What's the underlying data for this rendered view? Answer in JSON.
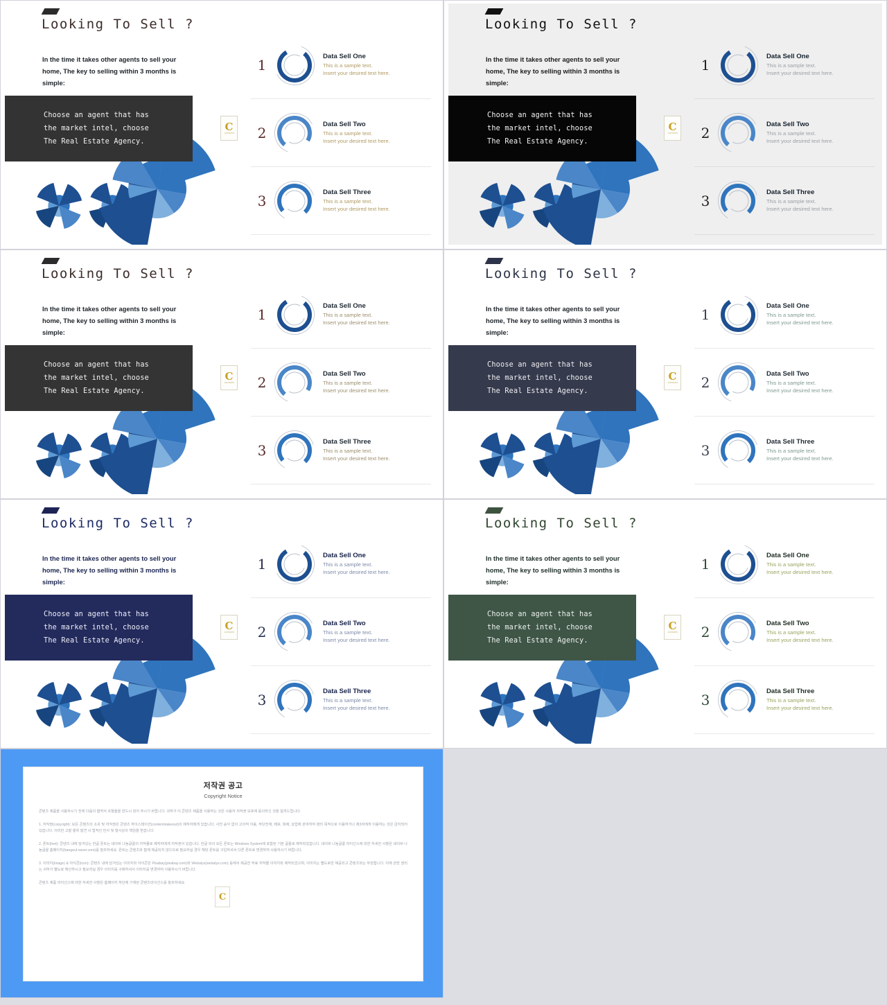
{
  "slides": [
    {
      "id": "slide-1",
      "title": "Looking To Sell ?",
      "intro": "In the time it takes other agents to sell your home, The key to selling within 3 months is simple:",
      "quote": "Choose an agent that has\nthe market intel, choose\nThe Real Estate Agency.",
      "logo_letter": "C",
      "logo_sub": "CONTENTS",
      "items": [
        {
          "num": "1",
          "title": "Data Sell One",
          "line1": "This is a sample text.",
          "line2": "Insert your desired text here."
        },
        {
          "num": "2",
          "title": "Data Sell Two",
          "line1": "This is a sample text.",
          "line2": "Insert your desired text here."
        },
        {
          "num": "3",
          "title": "Data Sell Three",
          "line1": "This is a sample text.",
          "line2": "Insert your desired text here."
        }
      ],
      "colors": {
        "bg": "#ffffff",
        "slash": "#2b2b2b",
        "title": "#3a2b28",
        "intro": "#20262c",
        "box": "#333333",
        "quotefg": "#f4f4f4",
        "num": "#5c2b2b",
        "dtitle": "#1f2933",
        "dsub": "#b09a62",
        "rule": "#e8e8e8"
      }
    },
    {
      "id": "slide-2",
      "title": "Looking To Sell ?",
      "intro": "In the time it takes other agents to sell your home, The key to selling within 3 months is simple:",
      "quote": "Choose an agent that has\nthe market intel, choose\nThe Real Estate Agency.",
      "logo_letter": "C",
      "logo_sub": "CONTENTS",
      "items": [
        {
          "num": "1",
          "title": "Data Sell One",
          "line1": "This is a sample text.",
          "line2": "Insert your desired text here."
        },
        {
          "num": "2",
          "title": "Data Sell Two",
          "line1": "This is a sample text.",
          "line2": "Insert your desired text here."
        },
        {
          "num": "3",
          "title": "Data Sell Three",
          "line1": "This is a sample text.",
          "line2": "Insert your desired text here."
        }
      ],
      "colors": {
        "bg": "#efefef",
        "slash": "#111111",
        "title": "#111111",
        "intro": "#1c1c1c",
        "box": "#060606",
        "quotefg": "#f4f4f4",
        "num": "#202020",
        "dtitle": "#15212e",
        "dsub": "#9aa0a6",
        "rule": "#dcdcdc"
      }
    },
    {
      "id": "slide-3",
      "title": "Looking To Sell ?",
      "intro": "In the time it takes other agents to sell your home, The key to selling within 3 months is simple:",
      "quote": "Choose an agent that has\nthe market intel, choose\nThe Real Estate Agency.",
      "logo_letter": "C",
      "logo_sub": "CONTENTS",
      "items": [
        {
          "num": "1",
          "title": "Data Sell One",
          "line1": "This is a sample text.",
          "line2": "Insert your desired text here."
        },
        {
          "num": "2",
          "title": "Data Sell Two",
          "line1": "This is a sample text.",
          "line2": "Insert your desired text here."
        },
        {
          "num": "3",
          "title": "Data Sell Three",
          "line1": "This is a sample text.",
          "line2": "Insert your desired text here."
        }
      ],
      "colors": {
        "bg": "#ffffff",
        "slash": "#2b2b2b",
        "title": "#3a2b28",
        "intro": "#20262c",
        "box": "#343434",
        "quotefg": "#f4f4f4",
        "num": "#5c2b2b",
        "dtitle": "#1f2933",
        "dsub": "#9c8f6e",
        "rule": "#e8e8e8"
      }
    },
    {
      "id": "slide-4",
      "title": "Looking To Sell ?",
      "intro": "In the time it takes other agents to sell your home, The key to selling within 3 months is simple:",
      "quote": "Choose an agent that has\nthe market intel, choose\nThe Real Estate Agency.",
      "logo_letter": "C",
      "logo_sub": "CONTENTS",
      "items": [
        {
          "num": "1",
          "title": "Data Sell One",
          "line1": "This is a sample text.",
          "line2": "Insert your desired text here."
        },
        {
          "num": "2",
          "title": "Data Sell Two",
          "line1": "This is a sample text.",
          "line2": "Insert your desired text here."
        },
        {
          "num": "3",
          "title": "Data Sell Three",
          "line1": "This is a sample text.",
          "line2": "Insert your desired text here."
        }
      ],
      "colors": {
        "bg": "#ffffff",
        "slash": "#2d3348",
        "title": "#2c3344",
        "intro": "#20262c",
        "box": "#353a4d",
        "quotefg": "#f0f0f2",
        "num": "#3a4152",
        "dtitle": "#1f2933",
        "dsub": "#7f9a8e",
        "rule": "#e8e8e8"
      }
    },
    {
      "id": "slide-5",
      "title": "Looking To Sell ?",
      "intro": "In the time it takes other agents to sell your home, The key to selling within 3 months is simple:",
      "quote": "Choose an agent that has\nthe market intel, choose\nThe Real Estate Agency.",
      "logo_letter": "C",
      "logo_sub": "CONTENTS",
      "items": [
        {
          "num": "1",
          "title": "Data Sell One",
          "line1": "This is a sample text.",
          "line2": "Insert your desired text here."
        },
        {
          "num": "2",
          "title": "Data Sell Two",
          "line1": "This is a sample text.",
          "line2": "Insert your desired text here."
        },
        {
          "num": "3",
          "title": "Data Sell Three",
          "line1": "This is a sample text.",
          "line2": "Insert your desired text here."
        }
      ],
      "colors": {
        "bg": "#ffffff",
        "slash": "#1d2455",
        "title": "#1d2a63",
        "intro": "#1b2550",
        "box": "#232a5c",
        "quotefg": "#eef0f8",
        "num": "#26314f",
        "dtitle": "#17224a",
        "dsub": "#7d8aa8",
        "rule": "#e8e8e8"
      }
    },
    {
      "id": "slide-6",
      "title": "Looking To Sell ?",
      "intro": "In the time it takes other agents to sell your home, The key to selling within 3 months is simple:",
      "quote": "Choose an agent that has\nthe market intel, choose\nThe Real Estate Agency.",
      "logo_letter": "C",
      "logo_sub": "CONTENTS",
      "items": [
        {
          "num": "1",
          "title": "Data Sell One",
          "line1": "This is a sample text.",
          "line2": "Insert your desired text here."
        },
        {
          "num": "2",
          "title": "Data Sell Two",
          "line1": "This is a sample text.",
          "line2": "Insert your desired text here."
        },
        {
          "num": "3",
          "title": "Data Sell Three",
          "line1": "This is a sample text.",
          "line2": "Insert your desired text here."
        }
      ],
      "colors": {
        "bg": "#ffffff",
        "slash": "#3e5240",
        "title": "#30452f",
        "intro": "#22312b",
        "box": "#3f5647",
        "quotefg": "#eef2ee",
        "num": "#2f4a34",
        "dtitle": "#1f2e23",
        "dsub": "#9aa35f",
        "rule": "#e8e8e8"
      }
    }
  ],
  "graphics": {
    "ring_colors": [
      "#1d4f91",
      "#4a86c8",
      "#2f74bd"
    ],
    "ring_inner_color": "#b9c0c9",
    "pinwheel_palette": [
      "#1d4f91",
      "#2f74bd",
      "#4a86c8",
      "#7fb0de",
      "#17457f",
      "#5e9ad4"
    ]
  },
  "copyright": {
    "heading_ko": "저작권 공고",
    "heading_en": "Copyright Notice",
    "logo_letter": "C",
    "paragraphs": [
      "콘텐츠 제품을 사용하시기 전에 다음의 협약서 조항들을 반드시 읽어 주시기 바랍니다. 귀하가 이 콘텐츠 제품을 사용하는 것은 사용자 저작권 보호에 동의하신 것을 알려드립니다.",
      "1. 저작권(copyright): 모든 콘텐츠의 소유 및 저작권은 콘텐츠 하이스테이션(contentstakeout)의 제작자에게 있습니다. 사전 승낙 없이 고의적 이용, 무단전재, 배포, 복제, 상업에 관여하여 영리 목적으로 이용하거나 제3자에게 이용하는 것은 금지되어 있습니다. 이러한 고발 행위 발견 시 법적인 민사 및 형사상의 책임을 받습니다.",
      "2. 폰트(font): 콘텐츠 내에 담겨있는 한글 폰트는 네이버 나눔글꼴의 저작물로 제작자에게 저작권이 있습니다. 한글 외의 모든 폰트는 Windows System에 포함된 기본 글꼴로 제작되었습니다. 네이버 나눔글꼴 라이선스에 대한 자세한 사항은 네이버 나눔글꼴 홈페이지(hangeul.naver.com)를 참조하세요. 폰트는 콘텐츠와 함께 제공되지 않으므로 필요하실 경우 해당 폰트를 구입하셔서 다른 폰트로 변경하여 사용하시기 바랍니다.",
      "3. 이미지(image) & 아이콘(icon): 콘텐츠 내에 담겨있는 이미지와 아이콘은 Pixabay(pixabay.com)와 Webalys(webalys.com) 등에서 제공한 무료 저작물 이미지와 제작되었으며, 이미지는 별도로만 제공되고 콘텐츠와는 무관합니다. 이에 관한 권리는 귀하가 별도로 확인하시고 필요하실 경우 이미지를 구매하셔서 이미지를 변경하여 사용하시기 바랍니다.",
      "콘텐츠 제품 라이선스에 대한 자세한 사항은 홈페이지 하단에 기재된 콘텐츠라이선스를 참조하세요."
    ]
  }
}
